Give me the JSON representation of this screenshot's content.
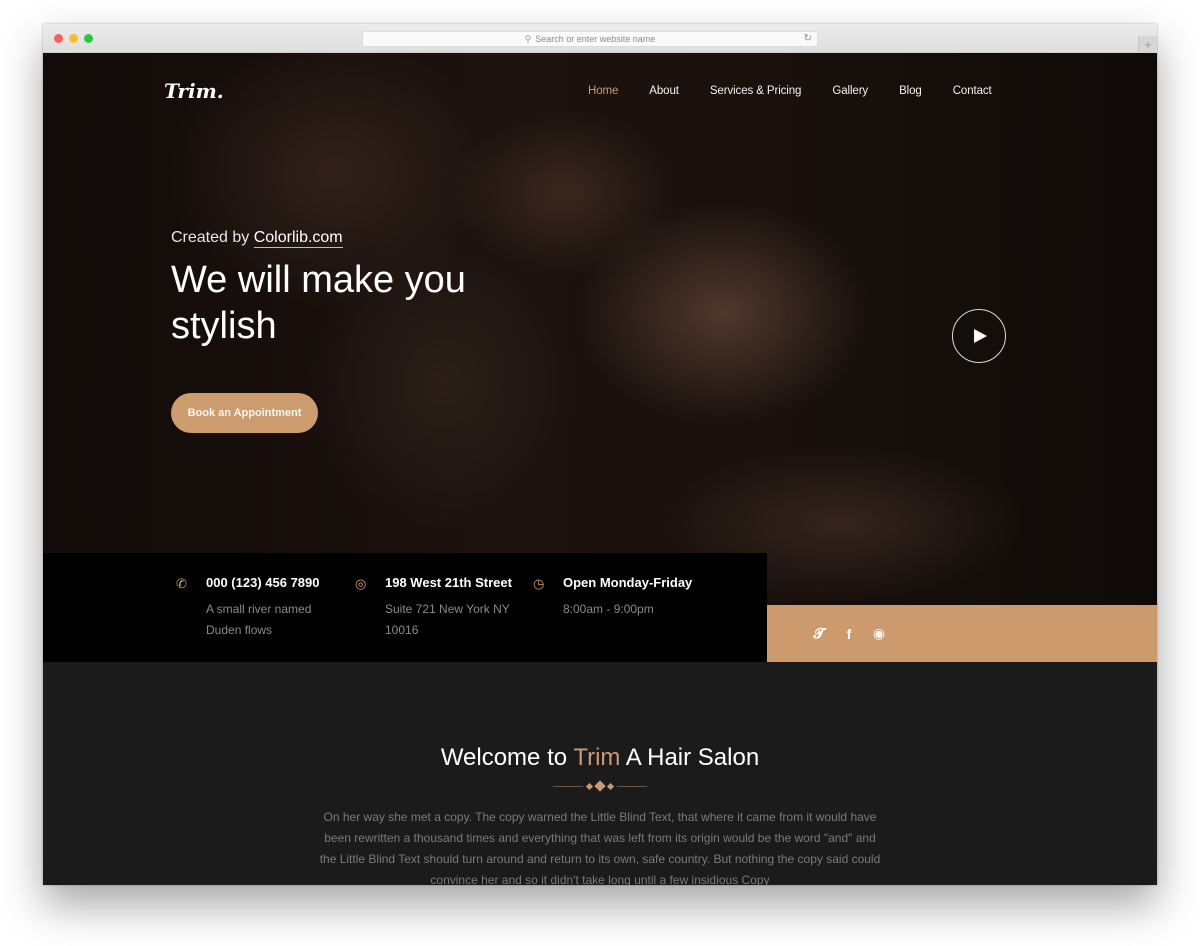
{
  "browser": {
    "url_placeholder": "Search or enter website name",
    "search_icon": "magnifier-icon",
    "reload_icon": "reload-icon",
    "new_tab_label": "+"
  },
  "site": {
    "logo": "Trim.",
    "nav": [
      {
        "label": "Home",
        "active": true
      },
      {
        "label": "About"
      },
      {
        "label": "Services & Pricing"
      },
      {
        "label": "Gallery"
      },
      {
        "label": "Blog"
      },
      {
        "label": "Contact"
      }
    ],
    "accent_color": "#c99b72"
  },
  "hero": {
    "created_prefix": "Created by",
    "created_link": "Colorlib.com",
    "headline": "We will make you stylish",
    "cta": "Book an Appointment",
    "play_icon": "play-icon"
  },
  "info": [
    {
      "icon": "phone-icon",
      "title": "000 (123) 456 7890",
      "sub1": "A small river named",
      "sub2": "Duden flows"
    },
    {
      "icon": "location-icon",
      "title": "198 West 21th Street",
      "sub1": "Suite 721 New York NY",
      "sub2": "10016"
    },
    {
      "icon": "clock-icon",
      "title": "Open Monday-Friday",
      "sub1": "8:00am - 9:00pm",
      "sub2": ""
    }
  ],
  "social": {
    "twitter": "twitter-icon",
    "facebook": "facebook-icon",
    "instagram": "instagram-icon"
  },
  "welcome": {
    "title_pre": "Welcome to",
    "title_accent": "Trim",
    "title_post": "A Hair Salon",
    "body": "On her way she met a copy. The copy warned the Little Blind Text, that where it came from it would have been rewritten a thousand times and everything that was left from its origin would be the word \"and\" and the Little Blind Text should turn around and return to its own, safe country. But nothing the copy said could convince her and so it didn't take long until a few insidious Copy"
  }
}
